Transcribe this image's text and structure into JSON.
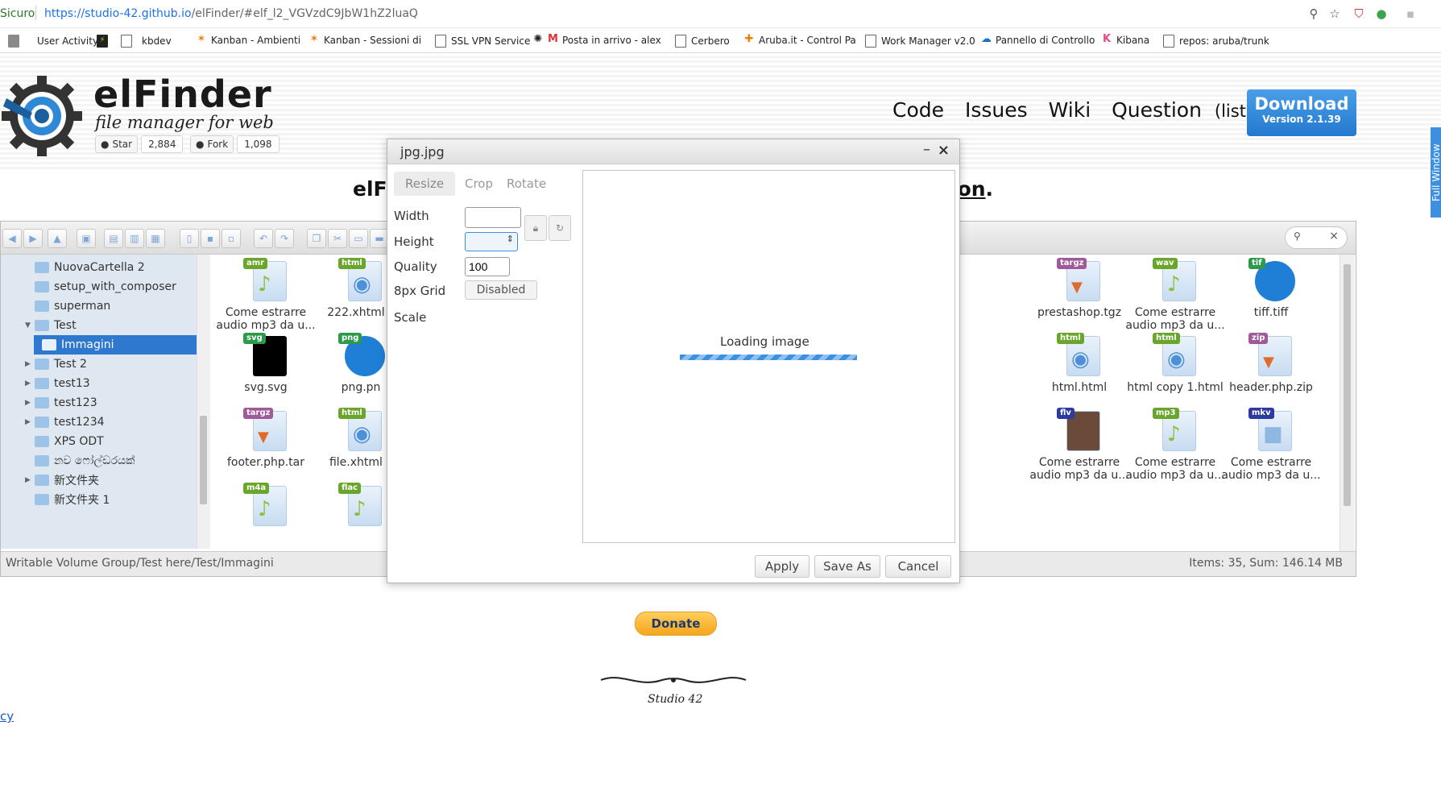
{
  "browser": {
    "secure_label": "Sicuro",
    "url_host": "https://studio-42.github.io",
    "url_path": "/elFinder/#elf_l2_VGVzdC9JbW1hZ2luaQ"
  },
  "bookmarks": [
    {
      "label": "User Activity",
      "icon": "page-icon"
    },
    {
      "label": "kbdev",
      "icon": "page-icon"
    },
    {
      "label": "Kanban - Ambienti",
      "icon": "kanban-icon"
    },
    {
      "label": "Kanban - Sessioni di",
      "icon": "kanban-icon"
    },
    {
      "label": "SSL VPN Service",
      "icon": "page-icon"
    },
    {
      "label": "Posta in arrivo - alex",
      "icon": "gmail-icon"
    },
    {
      "label": "Cerbero",
      "icon": "page-icon"
    },
    {
      "label": "Aruba.it - Control Pa",
      "icon": "aruba-icon"
    },
    {
      "label": "Work Manager v2.0",
      "icon": "page-icon"
    },
    {
      "label": "Pannello di Controllo",
      "icon": "cloud-icon"
    },
    {
      "label": "Kibana",
      "icon": "kibana-icon"
    },
    {
      "label": "repos: aruba/trunk",
      "icon": "page-icon"
    }
  ],
  "header": {
    "title": "elFinder",
    "subtitle": "file manager for web",
    "star_label": "Star",
    "star_count": "2,884",
    "fork_label": "Fork",
    "fork_count": "1,098",
    "nav": [
      "Code",
      "Issues",
      "Wiki",
      "Question"
    ],
    "nav_list": "(list)",
    "download_label": "Download",
    "download_version": "Version 2.1.39",
    "full_window": "Full Window",
    "tagline_left": "elFi",
    "tagline_right": "ion",
    "tagline_period": "."
  },
  "tree": [
    {
      "label": "NuovaCartella 2",
      "arrow": false
    },
    {
      "label": "setup_with_composer",
      "arrow": false
    },
    {
      "label": "superman",
      "arrow": false
    },
    {
      "label": "Test",
      "arrow": "open"
    },
    {
      "label": "Immagini",
      "arrow": false,
      "selected": true
    },
    {
      "label": "Test 2",
      "arrow": "closed"
    },
    {
      "label": "test13",
      "arrow": "closed"
    },
    {
      "label": "test123",
      "arrow": "closed"
    },
    {
      "label": "test1234",
      "arrow": "closed"
    },
    {
      "label": "XPS ODT",
      "arrow": false
    },
    {
      "label": "නව ෆෝල්ඩරයක්",
      "arrow": false
    },
    {
      "label": "新文件夹",
      "arrow": "closed"
    },
    {
      "label": "新文件夹 1",
      "arrow": false
    }
  ],
  "files_left": [
    {
      "name": "Come estrarre audio mp3 da u...",
      "badge": "amr",
      "badge_color": "#6aa52c"
    },
    {
      "name": "222.xhtml c",
      "badge": "html",
      "badge_color": "#6aa52c"
    },
    {
      "name": "svg.svg",
      "badge": "svg",
      "badge_color": "#2c9a4a"
    },
    {
      "name": "png.pn",
      "badge": "png",
      "badge_color": "#2c9a4a"
    },
    {
      "name": "footer.php.tar",
      "badge": "targz",
      "badge_color": "#a05a9a"
    },
    {
      "name": "file.xhtml c",
      "badge": "html",
      "badge_color": "#6aa52c"
    },
    {
      "name": "",
      "badge": "m4a",
      "badge_color": "#6aa52c"
    },
    {
      "name": "",
      "badge": "flac",
      "badge_color": "#6aa52c"
    }
  ],
  "files_right": [
    {
      "name": "prestashop.tgz",
      "badge": "targz",
      "badge_color": "#a05a9a"
    },
    {
      "name": "Come estrarre audio mp3 da u...",
      "badge": "wav",
      "badge_color": "#6aa52c"
    },
    {
      "name": "tiff.tiff",
      "badge": "tif",
      "badge_color": "#2c9a4a"
    },
    {
      "name": "html.html",
      "badge": "html",
      "badge_color": "#6aa52c"
    },
    {
      "name": "html copy 1.html",
      "badge": "html",
      "badge_color": "#6aa52c"
    },
    {
      "name": "header.php.zip",
      "badge": "zip",
      "badge_color": "#a05a9a"
    },
    {
      "name": "Come estrarre audio mp3 da u...",
      "badge": "flv",
      "badge_color": "#2d3aa0"
    },
    {
      "name": "Come estrarre audio mp3 da u...",
      "badge": "mp3",
      "badge_color": "#6aa52c"
    },
    {
      "name": "Come estrarre audio mp3 da u...",
      "badge": "mkv",
      "badge_color": "#2d3aa0"
    }
  ],
  "status": {
    "path": "Writable Volume Group/Test here/Test/Immagini",
    "summary": "Items: 35, Sum: 146.14 MB"
  },
  "dialog": {
    "title": "jpg.jpg",
    "tabs": [
      "Resize",
      "Crop",
      "Rotate"
    ],
    "width_label": "Width",
    "width_value": "",
    "height_label": "Height",
    "quality_label": "Quality",
    "quality_value": "100",
    "grid_label": "8px Grid",
    "grid_value": "Disabled",
    "scale_label": "Scale",
    "loading_text": "Loading image",
    "apply": "Apply",
    "save_as": "Save As",
    "cancel": "Cancel"
  },
  "footer": {
    "donate": "Donate",
    "studio": "Studio 42",
    "link_fragment": "cy"
  }
}
